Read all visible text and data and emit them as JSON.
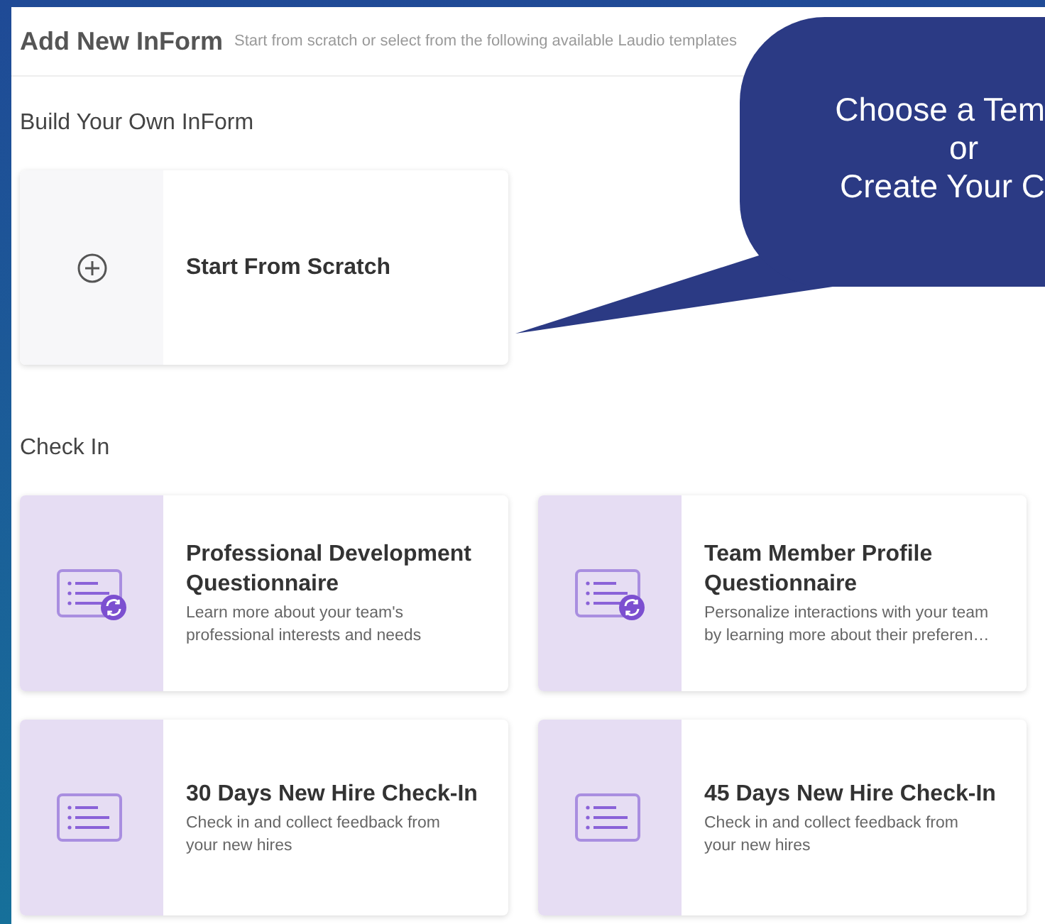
{
  "header": {
    "title": "Add New InForm",
    "subtitle": "Start from scratch or select from the following available Laudio templates"
  },
  "sections": [
    {
      "title": "Build Your Own InForm",
      "cards": [
        {
          "kind": "scratch",
          "title": "Start From Scratch"
        }
      ]
    },
    {
      "title": "Check In",
      "cards": [
        {
          "kind": "template",
          "title": "Professional Development Questionnaire",
          "description": "Learn more about your team's professional interests and needs",
          "sync_badge": true
        },
        {
          "kind": "template",
          "title": "Team Member Profile Questionnaire",
          "description": "Personalize interactions with your team by learning more about their preferen…",
          "sync_badge": true
        },
        {
          "kind": "template",
          "title": "30 Days New Hire Check-In",
          "description": "Check in and collect feedback from your new hires",
          "sync_badge": false
        },
        {
          "kind": "template",
          "title": "45 Days New Hire Check-In",
          "description": "Check in and collect feedback from your new hires",
          "sync_badge": false
        }
      ]
    }
  ],
  "callout": {
    "lines": [
      "Choose a Tem",
      "or",
      "Create Your C"
    ]
  }
}
